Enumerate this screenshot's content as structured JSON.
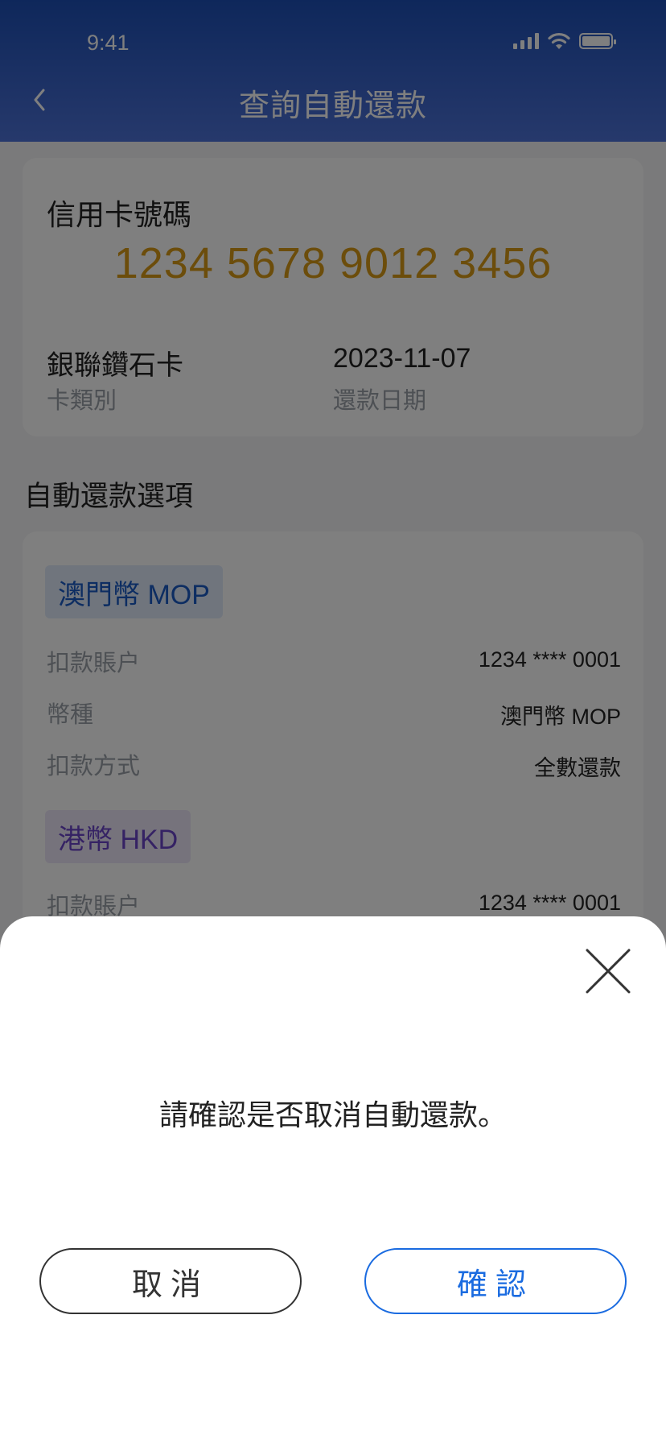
{
  "status_bar": {
    "time": "9:41"
  },
  "header": {
    "title": "查詢自動還款"
  },
  "card": {
    "label": "信用卡號碼",
    "number": "1234 5678 9012 3456",
    "type_value": "銀聯鑽石卡",
    "type_label": "卡類別",
    "date_value": "2023-11-07",
    "date_label": "還款日期"
  },
  "options": {
    "section_title": "自動還款選項",
    "mop": {
      "chip": "澳門幣 MOP",
      "rows": [
        {
          "label": "扣款賬户",
          "value": "1234 **** 0001"
        },
        {
          "label": "幣種",
          "value": "澳門幣 MOP"
        },
        {
          "label": "扣款方式",
          "value": "全數還款"
        }
      ]
    },
    "hkd": {
      "chip": "港幣 HKD",
      "rows": [
        {
          "label": "扣款賬户",
          "value": "1234 **** 0001"
        }
      ]
    }
  },
  "dialog": {
    "message": "請確認是否取消自動還款。",
    "cancel_label": "取消",
    "confirm_label": "確認"
  },
  "colors": {
    "header": "#1d4fb6",
    "card_number": "#d99a16",
    "mop_chip": "#1a5bc4",
    "hkd_chip": "#6a45c9",
    "confirm": "#1a6be0"
  },
  "icons": {
    "back": "chevron-left-icon",
    "close": "close-icon",
    "signal": "signal-icon",
    "wifi": "wifi-icon",
    "battery": "battery-icon"
  }
}
